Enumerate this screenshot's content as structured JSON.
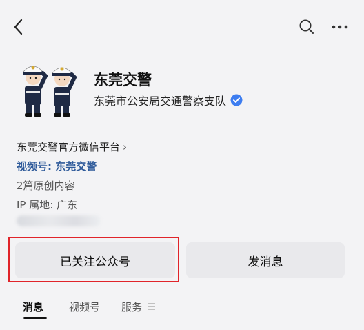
{
  "header": {
    "back_icon": "chevron-left-icon",
    "search_icon": "search-icon",
    "more_icon": "more-horizontal-icon"
  },
  "profile": {
    "name": "东莞交警",
    "verified_org": "东莞市公安局交通警察支队",
    "badge_color": "#3d7df0",
    "wechat_platform": "东莞交警官方微信平台",
    "video_channel": "视频号: 东莞交警",
    "original_count": "2篇原创内容",
    "ip_location": "IP 属地:  广东"
  },
  "actions": {
    "follow_label": "已关注公众号",
    "message_label": "发消息",
    "highlight_color": "#e0242a"
  },
  "tabs": [
    {
      "label": "消息",
      "active": true
    },
    {
      "label": "视频号",
      "active": false
    },
    {
      "label": "服务",
      "active": false
    }
  ]
}
